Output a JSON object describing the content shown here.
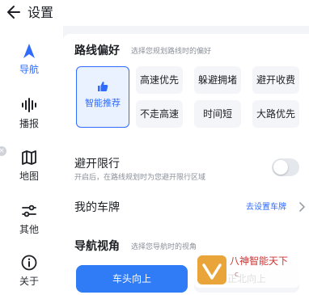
{
  "header": {
    "title": "设置"
  },
  "sidebar": {
    "items": [
      {
        "label": "导航",
        "icon": "navigation-arrow-icon",
        "active": true
      },
      {
        "label": "播报",
        "icon": "audio-wave-icon",
        "active": false
      },
      {
        "label": "地图",
        "icon": "map-icon",
        "active": false
      },
      {
        "label": "其他",
        "icon": "sliders-icon",
        "active": false
      },
      {
        "label": "关于",
        "icon": "info-icon",
        "active": false
      }
    ]
  },
  "route_pref": {
    "title": "路线偏好",
    "hint": "选择您规划路线时的偏好",
    "smart": "智能推荐",
    "options": [
      "高速优先",
      "躲避拥堵",
      "避开收费",
      "不走高速",
      "时间短",
      "大路优先"
    ]
  },
  "avoid_limit": {
    "title": "避开限行",
    "desc": "开启后，在路线规划时为您避开限行区域",
    "enabled": false
  },
  "plate": {
    "title": "我的车牌",
    "link": "去设置车牌"
  },
  "view": {
    "title": "导航视角",
    "hint": "选择您导航时的视角",
    "options": [
      "车头向上",
      "正北向上"
    ],
    "selected": "车头向上"
  },
  "watermark": {
    "text": "八神智能天下",
    "sub": "c"
  },
  "colors": {
    "accent": "#2f6bff",
    "button": "#2f7cf6",
    "chip_bg": "#f3f5f8"
  }
}
